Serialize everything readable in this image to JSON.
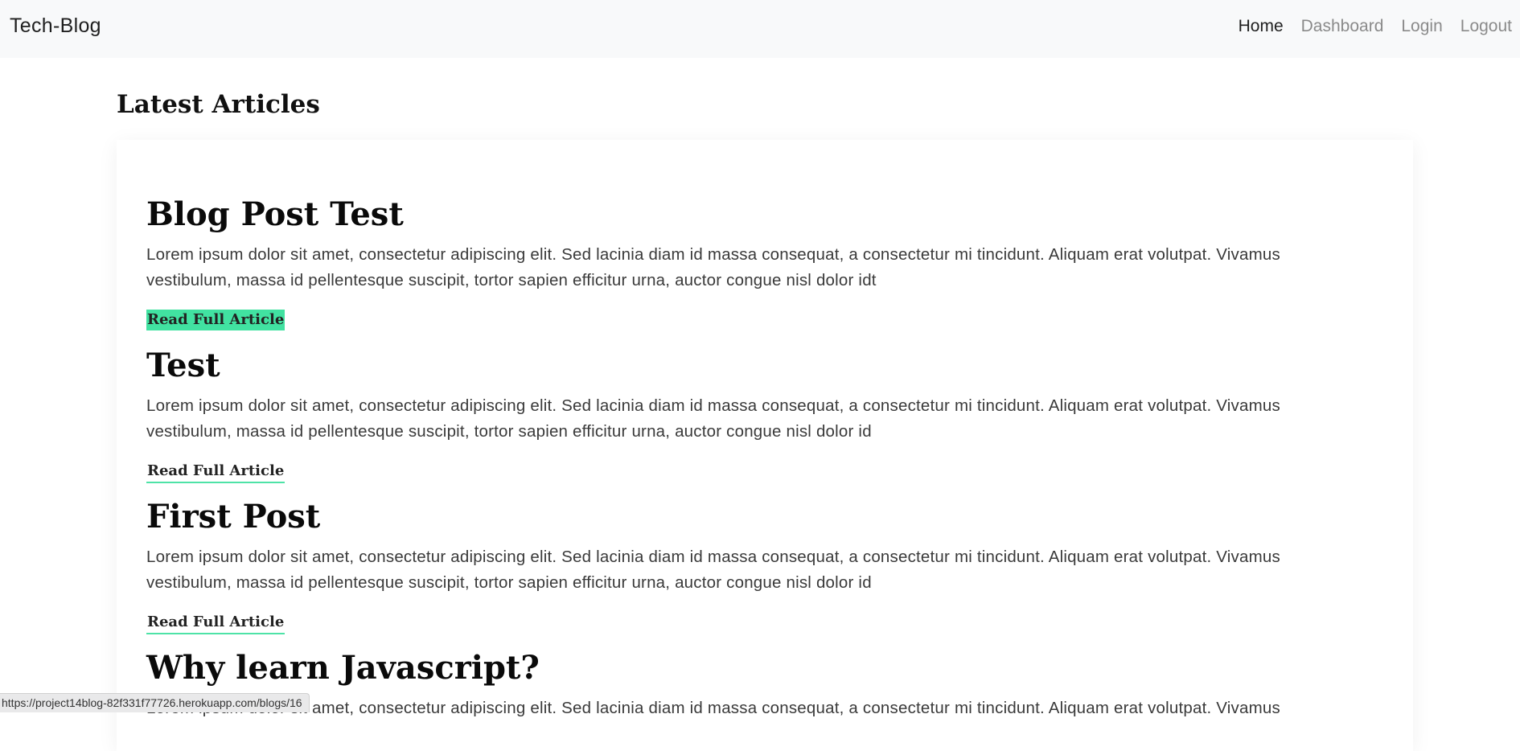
{
  "nav": {
    "brand": "Tech-Blog",
    "links": [
      {
        "label": "Home"
      },
      {
        "label": "Dashboard"
      },
      {
        "label": "Login"
      },
      {
        "label": "Logout"
      }
    ]
  },
  "main": {
    "heading": "Latest Articles",
    "articles": [
      {
        "title": "Blog Post Test",
        "excerpt": "Lorem ipsum dolor sit amet, consectetur adipiscing elit. Sed lacinia diam id massa consequat, a consectetur mi tincidunt. Aliquam erat volutpat. Vivamus vestibulum, massa id pellentesque suscipit, tortor sapien efficitur urna, auctor congue nisl dolor idt",
        "link_label": "Read Full Article"
      },
      {
        "title": "Test",
        "excerpt": "Lorem ipsum dolor sit amet, consectetur adipiscing elit. Sed lacinia diam id massa consequat, a consectetur mi tincidunt. Aliquam erat volutpat. Vivamus vestibulum, massa id pellentesque suscipit, tortor sapien efficitur urna, auctor congue nisl dolor id",
        "link_label": "Read Full Article"
      },
      {
        "title": "First Post",
        "excerpt": "Lorem ipsum dolor sit amet, consectetur adipiscing elit. Sed lacinia diam id massa consequat, a consectetur mi tincidunt. Aliquam erat volutpat. Vivamus vestibulum, massa id pellentesque suscipit, tortor sapien efficitur urna, auctor congue nisl dolor id",
        "link_label": "Read Full Article"
      },
      {
        "title": "Why learn Javascript?",
        "excerpt": "Lorem ipsum dolor sit amet, consectetur adipiscing elit. Sed lacinia diam id massa consequat, a consectetur mi tincidunt. Aliquam erat volutpat. Vivamus"
      }
    ]
  },
  "status_bar": {
    "url": "https://project14blog-82f331f77726.herokuapp.com/blogs/16"
  },
  "colors": {
    "accent": "#41e2a1",
    "navbar_bg": "#f8f9fa"
  }
}
